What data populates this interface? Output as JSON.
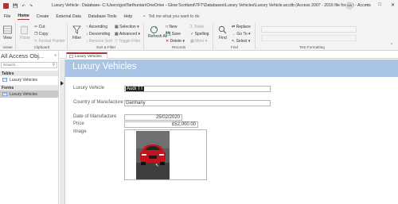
{
  "titlebar": {
    "title": "Luxury Vehicle : Database- C:\\Users\\godTarthunian\\OneDrive - Glow Scotland\\TFT\\Databases\\Luxury Vehicles\\Luxury Vehicle.accdb (Access 2007 - 2016 file format) - Access",
    "user_initials": "GA"
  },
  "tabs": {
    "items": [
      "File",
      "Home",
      "Create",
      "External Data",
      "Database Tools",
      "Help"
    ],
    "tell_me": "Tell me what you want to do"
  },
  "ribbon": {
    "views": {
      "view": "View",
      "label": "Views"
    },
    "clipboard": {
      "paste": "Paste",
      "cut": "Cut",
      "copy": "Copy",
      "format_painter": "Format Painter",
      "label": "Clipboard"
    },
    "sort_filter": {
      "filter": "Filter",
      "ascending": "Ascending",
      "descending": "Descending",
      "remove_sort": "Remove Sort",
      "selection": "Selection",
      "advanced": "Advanced",
      "toggle_filter": "Toggle Filter",
      "label": "Sort & Filter"
    },
    "records": {
      "refresh": "Refresh All",
      "new": "New",
      "save": "Save",
      "delete": "Delete",
      "totals": "Totals",
      "spelling": "Spelling",
      "more": "More",
      "label": "Records"
    },
    "find": {
      "find": "Find",
      "replace": "Replace",
      "goto": "Go To",
      "select": "Select",
      "label": "Find"
    },
    "text_formatting": {
      "label": "Text Formatting"
    }
  },
  "navpane": {
    "title": "All Access Obj...",
    "search_placeholder": "Search...",
    "sections": [
      {
        "name": "Tables",
        "items": [
          "Luxury Vehicles"
        ]
      },
      {
        "name": "Forms",
        "items": [
          "Luxury Vehicles"
        ]
      }
    ]
  },
  "object_tab": {
    "label": "Luxury Vehicles"
  },
  "form": {
    "title": "Luxury Vehicles",
    "fields": {
      "vehicle": {
        "label": "Luxury Vehicle",
        "value": "Audi TT"
      },
      "country": {
        "label": "Country of Manufacture",
        "value": "Germany"
      },
      "date": {
        "label": "Date of Manufacture",
        "value": "25/02/2020"
      },
      "price": {
        "label": "Price",
        "value": "£52,000.00"
      },
      "image": {
        "label": "Image"
      }
    }
  },
  "colors": {
    "accent": "#a4373a",
    "form_header": "#a9c4e4",
    "car": "#c5131b"
  }
}
